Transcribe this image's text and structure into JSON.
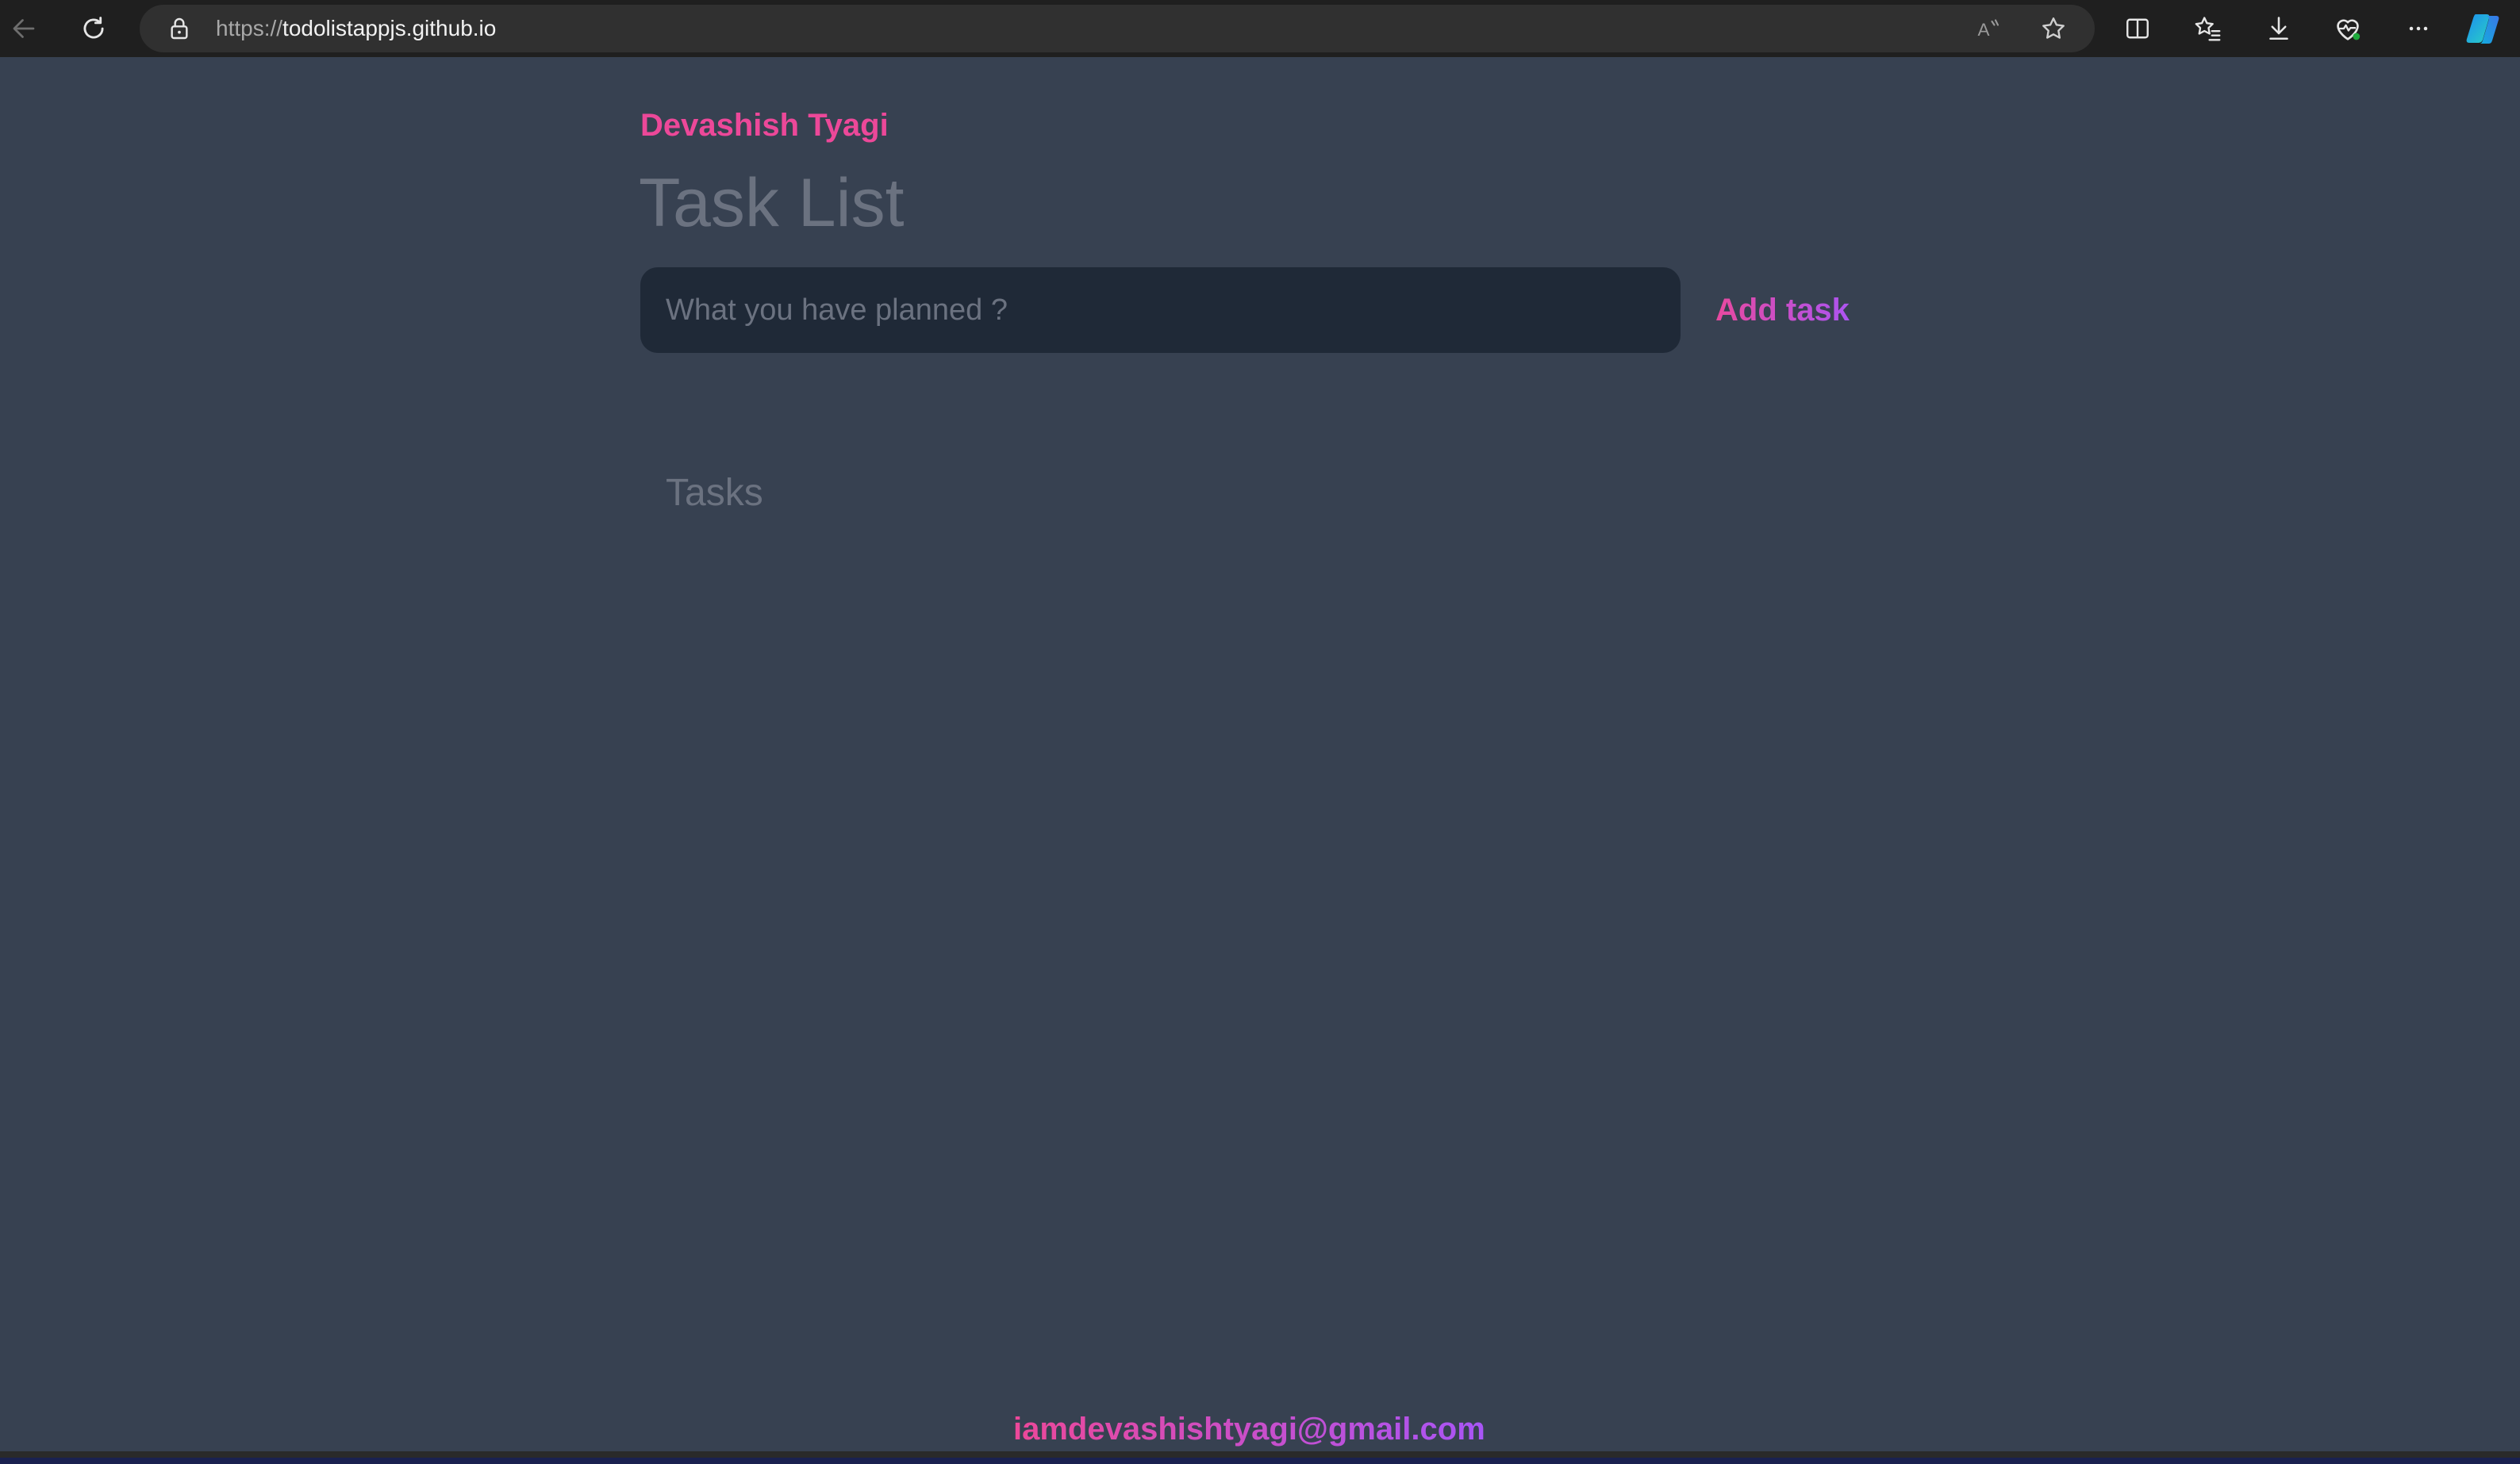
{
  "browser": {
    "url_scheme": "https://",
    "url_host": "todolistappjs.github.io"
  },
  "app": {
    "author_name": "Devashish Tyagi",
    "title": "Task List",
    "input": {
      "value": "",
      "placeholder": "What you have planned ?"
    },
    "add_button_label": "Add task",
    "tasks_heading": "Tasks",
    "tasks": [],
    "footer_email": "iamdevashishtyagi@gmail.com"
  },
  "colors": {
    "background": "#374151",
    "input_background": "#1f2937",
    "accent_pink": "#ec4899",
    "accent_purple": "#a855f7",
    "muted_text": "#6b7280",
    "browser_chrome": "#1f1f1f"
  },
  "icons": {
    "back": "back-arrow-icon",
    "refresh": "refresh-icon",
    "lock": "lock-icon",
    "read_aloud": "read-aloud-icon",
    "favorite": "star-icon",
    "split_screen": "split-screen-icon",
    "favorites": "favorites-list-icon",
    "downloads": "download-icon",
    "browser_essentials": "heart-pulse-icon",
    "more": "more-dots-icon",
    "copilot": "copilot-icon"
  }
}
